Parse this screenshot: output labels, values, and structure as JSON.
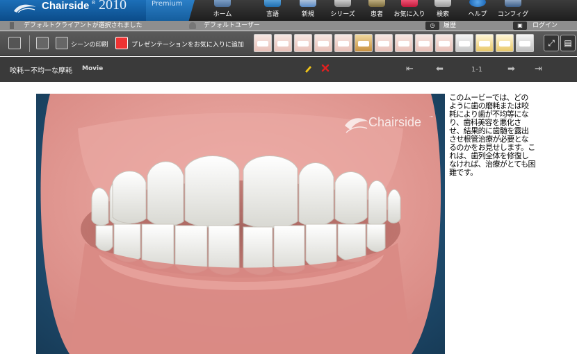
{
  "app": {
    "brand_name": "Chairside",
    "brand_registered": "®",
    "year": "2010",
    "edition": "Premium"
  },
  "topnav": [
    {
      "label": "ホーム",
      "icon": "home-icon"
    },
    {
      "label": "言語",
      "icon": "language-icon"
    },
    {
      "label": "新規",
      "icon": "new-icon"
    },
    {
      "label": "シリーズ",
      "icon": "series-icon"
    },
    {
      "label": "患者",
      "icon": "patient-icon"
    },
    {
      "label": "お気に入り",
      "icon": "favorites-icon"
    },
    {
      "label": "検索",
      "icon": "search-icon"
    },
    {
      "label": "ヘルプ",
      "icon": "help-icon"
    },
    {
      "label": "コンフィグ",
      "icon": "config-icon"
    }
  ],
  "infobar": {
    "client_status": "デフォルトクライアントが選択されました",
    "user": "デフォルトユーザー",
    "history": "履歴",
    "login": "ログイン"
  },
  "toolbar": {
    "print_scene": "シーンの印刷",
    "add_presentation_favorite": "プレゼンテーションをお気に入りに追加"
  },
  "titlebar": {
    "title": "咬耗－不均一な摩耗",
    "type": "Movie",
    "pager": "1-1"
  },
  "media": {
    "watermark": "Chairside",
    "watermark_tm": "™"
  },
  "description": "このムービーでは、どのように歯の磨耗または咬耗により歯が不均等になり、歯科美容を悪化させ、結果的に歯髄を露出させ根管治療が必要となるのかをお見せします。これは、歯列全体を修復しなければ、治療がとても困難です。",
  "colors": {
    "brand_blue": "#0b4c8a",
    "toolbar_gray": "#4f4f4f",
    "titlebar_dark": "#3a3a3a",
    "media_bg": "#245377",
    "edit_yellow": "#f0c419",
    "delete_red": "#e02020"
  }
}
